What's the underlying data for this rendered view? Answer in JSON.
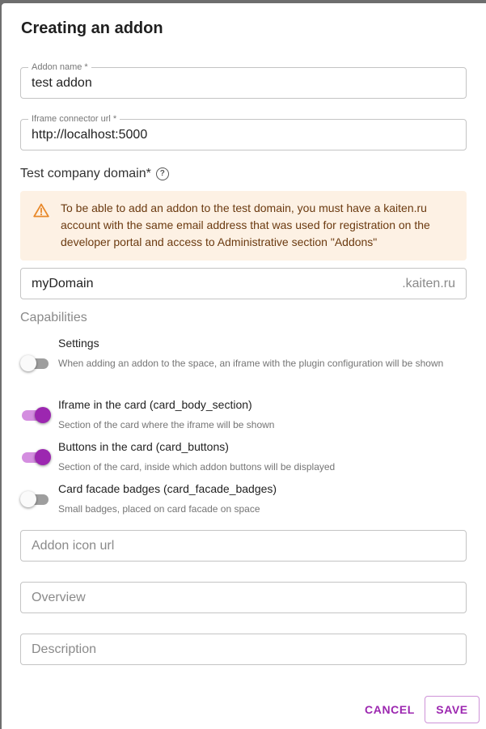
{
  "dialog": {
    "title": "Creating an addon"
  },
  "form": {
    "addon_name": {
      "label": "Addon name *",
      "value": "test addon"
    },
    "iframe_url": {
      "label": "Iframe connector url *",
      "value": "http://localhost:5000"
    },
    "test_domain": {
      "label": "Test company domain*",
      "help_icon": "question-circle-icon",
      "warning_icon": "warning-triangle-icon",
      "warning_text": "To be able to add an addon to the test domain, you must have a kaiten.ru account with the same email address that was used for registration on the developer portal and access to Administrative section \"Addons\"",
      "value": "myDomain",
      "suffix": ".kaiten.ru"
    },
    "capabilities": {
      "label": "Capabilities",
      "items": [
        {
          "title": "Settings",
          "description": "When adding an addon to the space, an iframe with the plugin configuration will be shown",
          "enabled": false
        },
        {
          "title": "Iframe in the card (card_body_section)",
          "description": "Section of the card where the iframe will be shown",
          "enabled": true
        },
        {
          "title": "Buttons in the card (card_buttons)",
          "description": "Section of the card, inside which addon buttons will be displayed",
          "enabled": true
        },
        {
          "title": "Card facade badges (card_facade_badges)",
          "description": "Small badges, placed on card facade on space",
          "enabled": false
        }
      ]
    },
    "addon_icon_url": {
      "placeholder": "Addon icon url"
    },
    "overview": {
      "placeholder": "Overview"
    },
    "description": {
      "placeholder": "Description"
    }
  },
  "actions": {
    "cancel_label": "CANCEL",
    "save_label": "SAVE"
  },
  "colors": {
    "accent": "#9c27b0",
    "warning_bg": "#fdf1e4",
    "warning_icon": "#e8892b"
  }
}
